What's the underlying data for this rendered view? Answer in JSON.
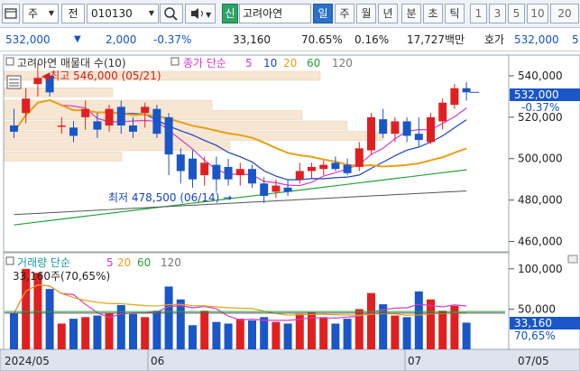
{
  "toolbar": {
    "market_label": "주",
    "query_label": "전",
    "stock_code": "010130",
    "credit_label": "신",
    "stock_name": "고려아연",
    "periods": [
      "일",
      "주",
      "월",
      "년",
      "분",
      "초",
      "틱"
    ],
    "active_period": "일",
    "numbers": [
      "1",
      "3",
      "5",
      "10",
      "20"
    ]
  },
  "quote": {
    "price": "532,000",
    "change": "2,000",
    "change_pct": "-0.37%",
    "volume": "33,160",
    "vol_ratio": "70.65%",
    "turnover": "0.16%",
    "amount": "17,727백만",
    "bid_label": "호가",
    "bid_price": "532,000",
    "tail": "5"
  },
  "chart": {
    "legend_title": "고려아연 매물대 수(10)",
    "ma_label": "종가 단순",
    "ma_periods": [
      "5",
      "10",
      "20",
      "60",
      "120"
    ],
    "high_note": "최고 546,000 (05/21)",
    "low_note": "최저 478,500 (06/14)",
    "price_ticks": [
      "540,000",
      "520,000",
      "500,000",
      "480,000",
      "460,000"
    ],
    "current_price": "532,000",
    "current_pct": "-0.37%",
    "volume_title": "거래량 단순",
    "volume_periods": [
      "5",
      "20",
      "60",
      "120"
    ],
    "volume_note": "33,160주(70,65%)",
    "volume_ticks": [
      "100,000",
      "50,000"
    ],
    "current_volume": "33,160",
    "current_vol_pct": "70,65%",
    "date_labels": [
      "2024/05",
      "06",
      "07",
      "07/05"
    ]
  },
  "chart_data": [
    {
      "type": "candlestick",
      "ylim": [
        455000,
        550000
      ],
      "close_ma_periods": [
        5,
        10,
        20,
        60,
        120
      ],
      "candles": [
        {
          "o": 516000,
          "h": 524000,
          "l": 510000,
          "c": 513000
        },
        {
          "o": 522000,
          "h": 534000,
          "l": 517000,
          "c": 529000
        },
        {
          "o": 536000,
          "h": 546000,
          "l": 530000,
          "c": 539000
        },
        {
          "o": 540000,
          "h": 541000,
          "l": 530000,
          "c": 532000
        },
        {
          "o": 516000,
          "h": 520000,
          "l": 512000,
          "c": 516000
        },
        {
          "o": 515000,
          "h": 518000,
          "l": 508000,
          "c": 511000
        },
        {
          "o": 520000,
          "h": 528000,
          "l": 514000,
          "c": 524000
        },
        {
          "o": 518000,
          "h": 522000,
          "l": 510000,
          "c": 514000
        },
        {
          "o": 516000,
          "h": 526000,
          "l": 513000,
          "c": 524000
        },
        {
          "o": 525000,
          "h": 528000,
          "l": 512000,
          "c": 516000
        },
        {
          "o": 516000,
          "h": 520000,
          "l": 510000,
          "c": 513000
        },
        {
          "o": 522000,
          "h": 527000,
          "l": 515000,
          "c": 525000
        },
        {
          "o": 524000,
          "h": 526000,
          "l": 510000,
          "c": 512000
        },
        {
          "o": 520000,
          "h": 522000,
          "l": 492000,
          "c": 502000
        },
        {
          "o": 502000,
          "h": 505000,
          "l": 488000,
          "c": 494000
        },
        {
          "o": 500000,
          "h": 504000,
          "l": 486000,
          "c": 490000
        },
        {
          "o": 492000,
          "h": 501000,
          "l": 487000,
          "c": 498000
        },
        {
          "o": 497000,
          "h": 501000,
          "l": 484000,
          "c": 490000
        },
        {
          "o": 496000,
          "h": 500000,
          "l": 487000,
          "c": 490000
        },
        {
          "o": 492000,
          "h": 498000,
          "l": 487000,
          "c": 495000
        },
        {
          "o": 495000,
          "h": 497000,
          "l": 486000,
          "c": 488000
        },
        {
          "o": 488000,
          "h": 491000,
          "l": 478500,
          "c": 482000
        },
        {
          "o": 484000,
          "h": 490000,
          "l": 481000,
          "c": 487000
        },
        {
          "o": 486000,
          "h": 490000,
          "l": 482000,
          "c": 484000
        },
        {
          "o": 490000,
          "h": 498000,
          "l": 488000,
          "c": 494000
        },
        {
          "o": 494000,
          "h": 498000,
          "l": 490000,
          "c": 496000
        },
        {
          "o": 495000,
          "h": 499000,
          "l": 492000,
          "c": 497000
        },
        {
          "o": 498000,
          "h": 501000,
          "l": 494000,
          "c": 495000
        },
        {
          "o": 497000,
          "h": 500000,
          "l": 492000,
          "c": 493000
        },
        {
          "o": 496000,
          "h": 508000,
          "l": 494000,
          "c": 505000
        },
        {
          "o": 504000,
          "h": 522000,
          "l": 502000,
          "c": 520000
        },
        {
          "o": 519000,
          "h": 524000,
          "l": 510000,
          "c": 512000
        },
        {
          "o": 512000,
          "h": 520000,
          "l": 508000,
          "c": 518000
        },
        {
          "o": 518000,
          "h": 520000,
          "l": 508000,
          "c": 511000
        },
        {
          "o": 512000,
          "h": 520000,
          "l": 506000,
          "c": 509000
        },
        {
          "o": 508000,
          "h": 522000,
          "l": 507000,
          "c": 520000
        },
        {
          "o": 518000,
          "h": 529000,
          "l": 514000,
          "c": 527000
        },
        {
          "o": 526000,
          "h": 536000,
          "l": 524000,
          "c": 534000
        },
        {
          "o": 534000,
          "h": 537000,
          "l": 528000,
          "c": 532000
        }
      ]
    },
    {
      "type": "bar",
      "series": [
        {
          "name": "거래량",
          "values": [
            45000,
            100000,
            95000,
            75000,
            32000,
            38000,
            40000,
            42000,
            45000,
            55000,
            44000,
            40000,
            48000,
            78000,
            62000,
            30000,
            48000,
            34000,
            32000,
            38000,
            36000,
            40000,
            34000,
            32000,
            44000,
            46000,
            40000,
            32000,
            38000,
            50000,
            70000,
            56000,
            42000,
            40000,
            72000,
            62000,
            48000,
            54000,
            33160
          ]
        }
      ],
      "ylim": [
        0,
        120000
      ]
    }
  ]
}
